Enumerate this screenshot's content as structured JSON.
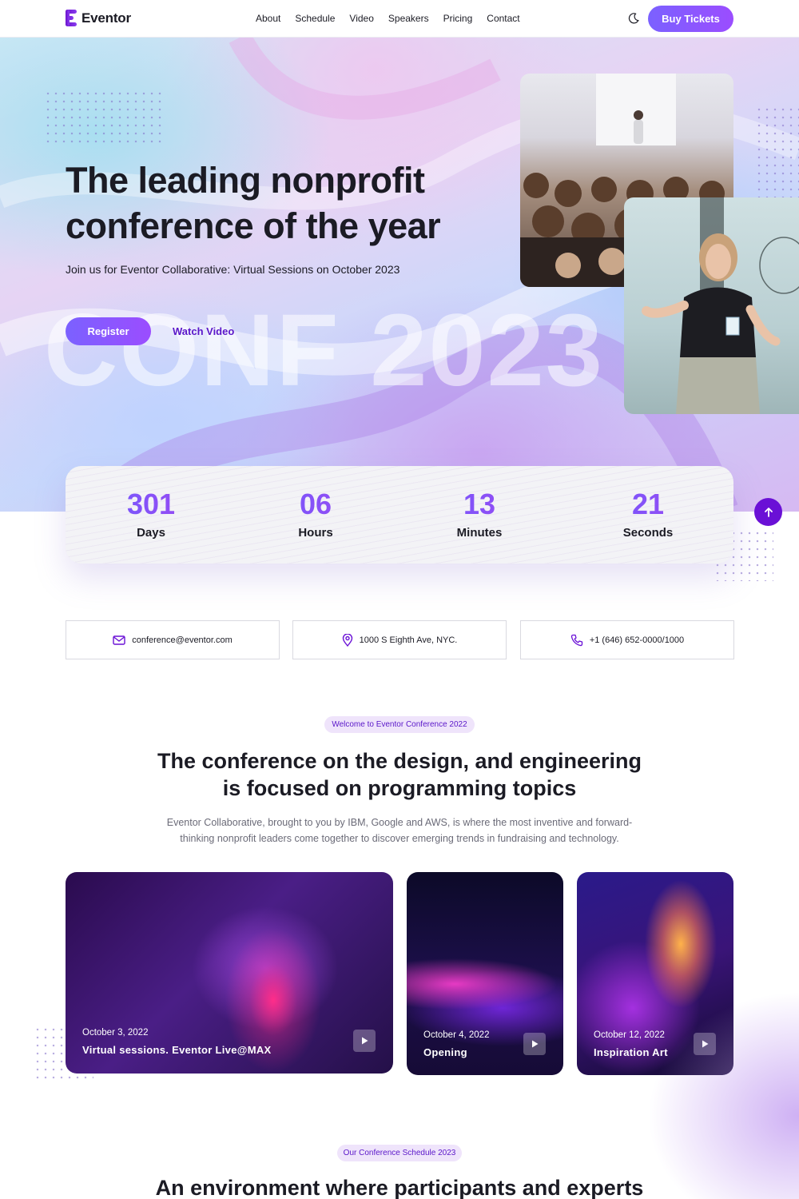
{
  "header": {
    "logo": "Eventor",
    "nav": [
      "About",
      "Schedule",
      "Video",
      "Speakers",
      "Pricing",
      "Contact"
    ],
    "buy_tickets": "Buy Tickets"
  },
  "hero": {
    "title_line1": "The leading nonprofit",
    "title_line2": "conference of the year",
    "subtitle": "Join us for Eventor Collaborative: Virtual Sessions on October 2023",
    "watermark": "CONF 2023",
    "register": "Register",
    "watch_video": "Watch Video"
  },
  "countdown": [
    {
      "value": "301",
      "label": "Days"
    },
    {
      "value": "06",
      "label": "Hours"
    },
    {
      "value": "13",
      "label": "Minutes"
    },
    {
      "value": "21",
      "label": "Seconds"
    }
  ],
  "contact": {
    "email": "conference@eventor.com",
    "address": "1000 S Eighth Ave, NYC.",
    "phone": "+1 (646) 652-0000/1000"
  },
  "about": {
    "badge": "Welcome to Eventor Conference 2022",
    "title_line1": "The conference on the design, and engineering",
    "title_line2": "is focused on programming topics",
    "text": "Eventor Collaborative, brought to you by IBM, Google and AWS, is where the most inventive and forward-thinking nonprofit leaders come together to discover emerging trends in fundraising and technology."
  },
  "sessions": [
    {
      "date": "October 3, 2022",
      "title": "Virtual sessions. Eventor Live@MAX"
    },
    {
      "date": "October 4, 2022",
      "title": "Opening"
    },
    {
      "date": "October 12, 2022",
      "title": "Inspiration Art"
    }
  ],
  "schedule": {
    "badge": "Our Conference Schedule 2023",
    "title": "An environment where participants and experts"
  },
  "colors": {
    "accent": "#7b61ff",
    "accent_dark": "#6a10d6",
    "text": "#1b1b24"
  }
}
